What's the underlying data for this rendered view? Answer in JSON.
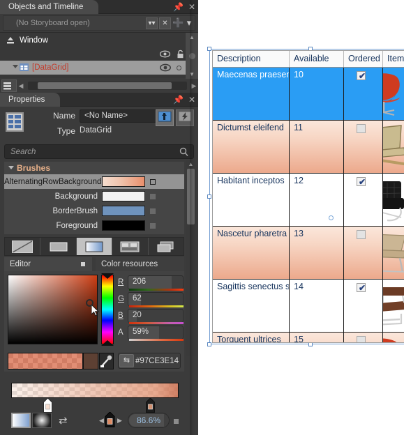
{
  "objects_panel": {
    "tab_label": "Objects and Timeline",
    "pin_icon": "pin-icon",
    "close_icon": "close-icon",
    "storyboard_text": "(No Storyboard open)",
    "storyboard_buttons": [
      "chevrons-down-icon",
      "close-x-icon",
      "plus-icon",
      "caret-down-icon"
    ],
    "tree": {
      "root_label": "Window",
      "root_icon": "upload-icon",
      "child_label": "[DataGrid]",
      "child_icon": "datagrid-icon",
      "expander_icon": "triangle-down-icon",
      "visibility_icon": "eye-icon",
      "lock_icon": "lock-icon"
    }
  },
  "properties_panel": {
    "tab_label": "Properties",
    "pin_icon": "pin-icon",
    "close_icon": "close-icon",
    "name_label": "Name",
    "name_value": "<No Name>",
    "type_label": "Type",
    "type_value": "DataGrid",
    "mode_buttons": [
      "properties-mode-icon",
      "events-mode-icon"
    ],
    "search_placeholder": "Search",
    "search_icon": "search-icon",
    "brushes": {
      "header": "Brushes",
      "rows": [
        {
          "name": "AlternatingRowBackground",
          "kind": "gradient",
          "selected": true,
          "advanced_icon": "advanced-options-square"
        },
        {
          "name": "Background",
          "kind": "solid",
          "color": "#f2f2f2",
          "selected": false,
          "advanced_icon": "advanced-options-square"
        },
        {
          "name": "BorderBrush",
          "kind": "solid",
          "color": "#6f93bd",
          "selected": false,
          "advanced_icon": "advanced-options-square"
        },
        {
          "name": "Foreground",
          "kind": "solid",
          "color": "#000000",
          "selected": false,
          "advanced_icon": "advanced-options-square"
        }
      ]
    },
    "brush_types": [
      {
        "name": "no-brush-icon",
        "active": false
      },
      {
        "name": "solid-color-brush-icon",
        "active": false
      },
      {
        "name": "gradient-brush-icon",
        "active": true
      },
      {
        "name": "tile-brush-icon",
        "active": false
      },
      {
        "name": "brush-resources-icon",
        "active": false
      }
    ],
    "editor_tabs": {
      "editor_label": "Editor",
      "editor_square_icon": "pin-square-icon",
      "color_resources_label": "Color resources"
    },
    "color_editor": {
      "channels": [
        {
          "label": "R",
          "value": "206"
        },
        {
          "label": "G",
          "value": "62"
        },
        {
          "label": "B",
          "value": "20"
        },
        {
          "label": "A",
          "value": "59%"
        }
      ],
      "hex_value": "#97CE3E14",
      "swap_icon": "swap-arrows-icon",
      "eyedropper_icon": "eyedropper-icon",
      "cursor_icon": "mouse-pointer-icon",
      "selected_rgb": "#ce3e14"
    },
    "gradient": {
      "stop_positions": [
        0,
        86.6
      ],
      "stop_colors": [
        "#f7e0d2",
        "#cb7253"
      ],
      "linear_icon": "linear-gradient-icon",
      "radial_icon": "radial-gradient-icon",
      "reverse_icon": "reverse-gradient-icon",
      "prev_stop_icon": "arrow-left-icon",
      "next_stop_icon": "arrow-right-icon",
      "offset_value": "86.6%",
      "advanced_icon": "advanced-options-square"
    }
  },
  "artboard": {
    "datagrid": {
      "columns": [
        "Description",
        "Available",
        "Ordered",
        "Item"
      ],
      "rows": [
        {
          "description": "Maecenas praesent",
          "available": "10",
          "ordered": true,
          "item_icon": "red-swan-chair",
          "state": "selected"
        },
        {
          "description": "Dictumst eleifend",
          "available": "11",
          "ordered": false,
          "item_icon": "wood-lounge-chair",
          "state": "alt"
        },
        {
          "description": "Habitant inceptos",
          "available": "12",
          "ordered": true,
          "item_icon": "black-barcelona-chair",
          "state": "plain"
        },
        {
          "description": "Nascetur pharetra",
          "available": "13",
          "ordered": false,
          "item_icon": "tan-lounge-chair",
          "state": "alt"
        },
        {
          "description": "Sagittis senectus s",
          "available": "14",
          "ordered": true,
          "item_icon": "brown-cantilever-chair",
          "state": "plain"
        },
        {
          "description": "Torquent ultrices",
          "available": "15",
          "ordered": false,
          "item_icon": "red-swan-chair",
          "state": "alt"
        }
      ]
    }
  }
}
